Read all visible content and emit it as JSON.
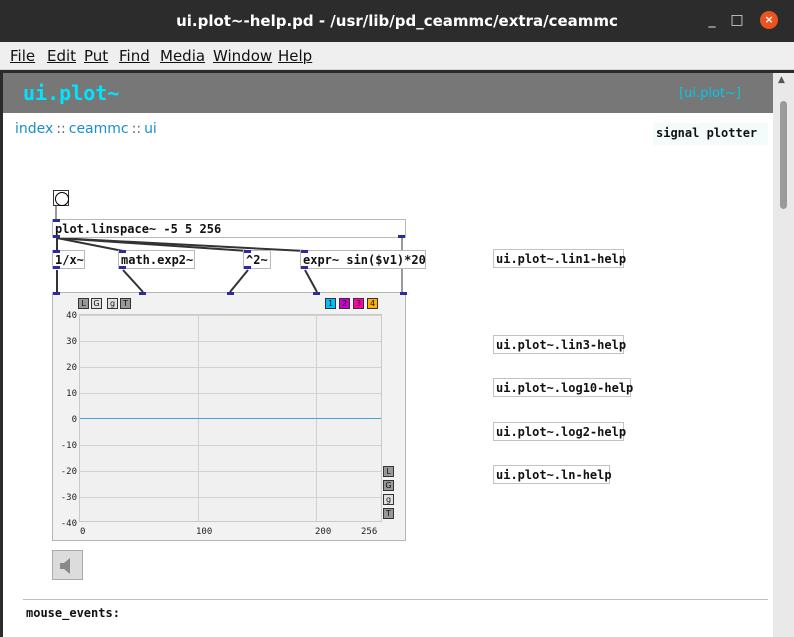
{
  "window": {
    "title": "ui.plot~-help.pd  - /usr/lib/pd_ceammc/extra/ceammc",
    "controls": {
      "minimize": "_",
      "maximize": "□",
      "close": "×"
    }
  },
  "menu": [
    "File",
    "Edit",
    "Put",
    "Find",
    "Media",
    "Window",
    "Help"
  ],
  "header": {
    "title": "ui.plot~",
    "link": "[ui.plot~]"
  },
  "breadcrumb": {
    "items": [
      "index",
      "ceammc",
      "ui"
    ],
    "separator": "::"
  },
  "description": "signal plotter",
  "objects": {
    "linspace": "plot.linspace~ -5 5 256",
    "recip": "1/x~",
    "exp2": "math.exp2~",
    "square": "^2~",
    "expr": "expr~ sin($v1)*20"
  },
  "help_links": [
    "ui.plot~.lin1-help",
    "ui.plot~.lin3-help",
    "ui.plot~.log10-help",
    "ui.plot~.log2-help",
    "ui.plot~.ln-help"
  ],
  "plot": {
    "top_buttons": [
      "L",
      "G",
      "g",
      "T"
    ],
    "channels": [
      {
        "label": "1",
        "color": "#00bfff"
      },
      {
        "label": "2",
        "color": "#cc00cc"
      },
      {
        "label": "3",
        "color": "#ff00aa"
      },
      {
        "label": "4",
        "color": "#ffb000"
      }
    ],
    "side_buttons": [
      "L",
      "G",
      "g",
      "T"
    ],
    "y_ticks": [
      "40",
      "30",
      "20",
      "10",
      "0",
      "-10",
      "-20",
      "-30",
      "-40"
    ],
    "x_ticks": [
      "0",
      "100",
      "200",
      "256"
    ],
    "trace_color": "#3fa6d6"
  },
  "mouse_events_label": "mouse_events:",
  "colors": {
    "header_bg": "#777777",
    "accent": "#00e5ff",
    "link": "#1b8ec9"
  },
  "icons": {
    "speaker": "speaker-icon",
    "bang": "bang-icon"
  }
}
